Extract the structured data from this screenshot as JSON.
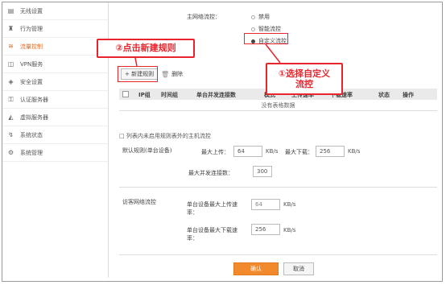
{
  "sidebar": {
    "items": [
      {
        "label": "无线设置",
        "icon": "wifi-icon"
      },
      {
        "label": "行为管理",
        "icon": "user-icon"
      },
      {
        "label": "流量控制",
        "icon": "traffic-icon"
      },
      {
        "label": "VPN服务",
        "icon": "vpn-icon"
      },
      {
        "label": "安全设置",
        "icon": "shield-icon"
      },
      {
        "label": "认证服务器",
        "icon": "auth-icon"
      },
      {
        "label": "虚拟服务器",
        "icon": "server-icon"
      },
      {
        "label": "系统状态",
        "icon": "status-icon"
      },
      {
        "label": "系统管理",
        "icon": "gear-icon"
      }
    ],
    "active_index": 2
  },
  "flow_control": {
    "label": "主网络流控：",
    "options": [
      "禁用",
      "智能流控",
      "自定义流控"
    ],
    "selected": "自定义流控"
  },
  "toolbar": {
    "new_rule": "+ 新建规则",
    "delete": "删除"
  },
  "table": {
    "headers": [
      "IP组",
      "时间组",
      "单台并发连接数",
      "模式",
      "上传速率",
      "下载速率",
      "状态",
      "操作"
    ],
    "empty_text": "没有表格数据"
  },
  "unlisted_note": "□ 列表内未启用规则表外的主机流控",
  "default_rule": {
    "label": "默认规则(单台设备)",
    "max_upload_label": "最大上传：",
    "max_upload_value": "64",
    "max_download_label": "最大下载：",
    "max_download_value": "256",
    "unit": "KB/s",
    "max_connections_label": "最大并发连接数：",
    "max_connections_value": "300"
  },
  "guest_flow": {
    "label": "访客网络流控",
    "upload_label": "单台设备最大上传速率：",
    "upload_value": "64",
    "download_label": "单台设备最大下载速率：",
    "download_value": "256",
    "unit": "KB/s"
  },
  "buttons": {
    "confirm": "确认",
    "cancel": "取消"
  },
  "annotations": {
    "step2": "②点击新建规则",
    "step1_line1": "①选择自定义",
    "step1_line2": "流控"
  }
}
